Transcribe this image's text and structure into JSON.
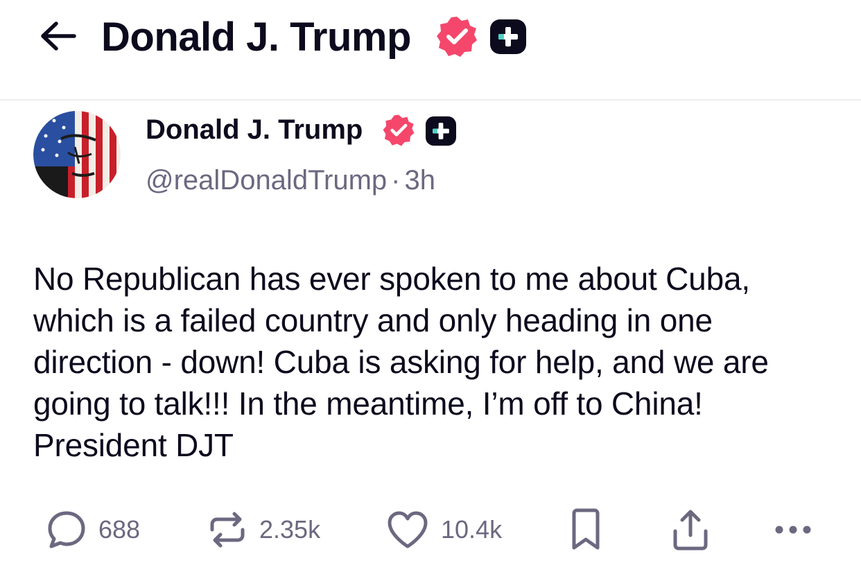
{
  "header": {
    "title": "Donald J. Trump",
    "back_icon": "arrow-left-icon",
    "verified_icon": "verified-badge-icon",
    "plus_icon": "truth-plus-icon"
  },
  "post": {
    "author_name": "Donald J. Trump",
    "handle": "@realDonaldTrump",
    "separator": "·",
    "time": "3h",
    "body": "No Republican has ever spoken to me about Cuba, which is a failed country and only heading in one direction - down! Cuba is asking for help, and we are going to talk!!! In the meantime, I’m off to China! President DJT"
  },
  "actions": {
    "replies": "688",
    "retruths": "2.35k",
    "likes": "10.4k"
  },
  "colors": {
    "text": "#0c0a1d",
    "muted": "#6b6880",
    "verified": "#f4476b",
    "plus_badge": "#0c0a1d",
    "plus_accent": "#4fd1c5"
  }
}
